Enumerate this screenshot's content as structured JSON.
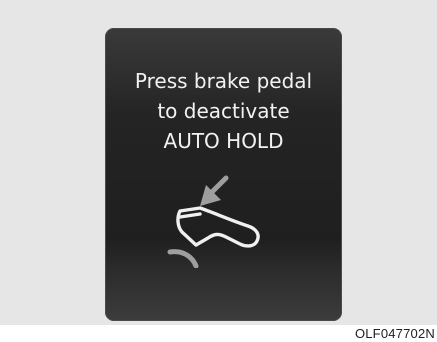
{
  "display": {
    "lines": [
      "Press brake pedal",
      "to deactivate",
      "AUTO HOLD"
    ],
    "icon": "brake-pedal-press-icon"
  },
  "figure_code": "OLF047702N",
  "colors": {
    "screen": "#242424",
    "text": "#f2f2f2",
    "arrow": "#9e9e9e",
    "frame": "#e6e6e6"
  }
}
